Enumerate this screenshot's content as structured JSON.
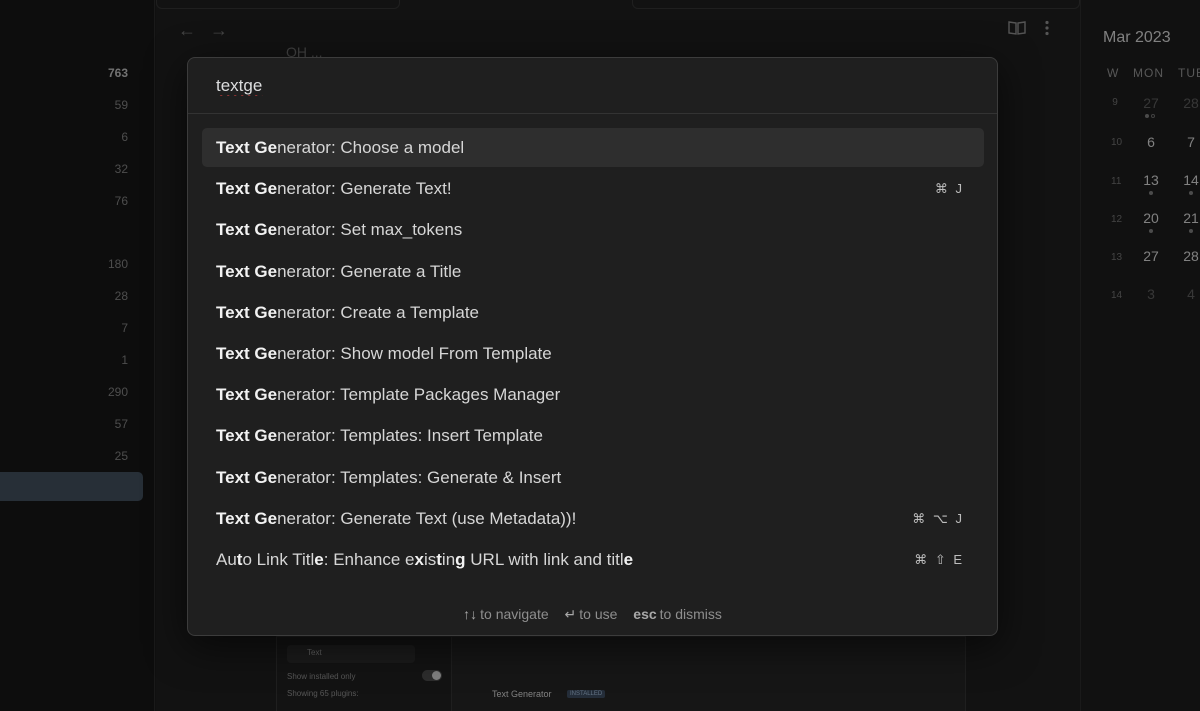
{
  "sidebar": {
    "counts": [
      "763",
      "59",
      "6",
      "32",
      "76",
      "180",
      "28",
      "7",
      "1",
      "290",
      "57",
      "25"
    ]
  },
  "main": {
    "back_icon": "arrow-left-icon",
    "forward_icon": "arrow-right-icon",
    "reading_icon": "book-open-icon",
    "more_icon": "more-vertical-icon",
    "background_title_fragment": "ОН ..."
  },
  "background_screenshot": {
    "search_value": "Text",
    "show_installed": "Show installed only",
    "showing_count": "Showing 65 plugins:",
    "plugin_name": "Text Generator",
    "badge": "INSTALLED"
  },
  "calendar": {
    "title": "Mar 2023",
    "headers": [
      "W",
      "MON",
      "TUE"
    ],
    "weeks": [
      {
        "week": "9",
        "mon": "27",
        "tue": "28",
        "muted": true
      },
      {
        "week": "10",
        "mon": "6",
        "tue": "7",
        "muted": false
      },
      {
        "week": "11",
        "mon": "13",
        "tue": "14",
        "muted": false
      },
      {
        "week": "12",
        "mon": "20",
        "tue": "21",
        "muted": false
      },
      {
        "week": "13",
        "mon": "27",
        "tue": "28",
        "muted": false
      },
      {
        "week": "14",
        "mon": "3",
        "tue": "4",
        "muted": true
      }
    ]
  },
  "palette": {
    "query": "textge",
    "items": [
      {
        "bold": "Text Ge",
        "rest": "nerator: Choose a model",
        "hotkey": ""
      },
      {
        "bold": "Text Ge",
        "rest": "nerator: Generate Text!",
        "hotkey": "⌘ J"
      },
      {
        "bold": "Text Ge",
        "rest": "nerator: Set max_tokens",
        "hotkey": ""
      },
      {
        "bold": "Text Ge",
        "rest": "nerator: Generate a Title",
        "hotkey": ""
      },
      {
        "bold": "Text Ge",
        "rest": "nerator: Create a Template",
        "hotkey": ""
      },
      {
        "bold": "Text Ge",
        "rest": "nerator: Show model From Template",
        "hotkey": ""
      },
      {
        "bold": "Text Ge",
        "rest": "nerator: Template Packages Manager",
        "hotkey": ""
      },
      {
        "bold": "Text Ge",
        "rest": "nerator: Templates: Insert Template",
        "hotkey": ""
      },
      {
        "bold": "Text Ge",
        "rest": "nerator: Templates: Generate & Insert",
        "hotkey": ""
      },
      {
        "bold": "Text Ge",
        "rest": "nerator: Generate Text (use Metadata))!",
        "hotkey": "⌘ ⌥ J"
      }
    ],
    "last_item": {
      "parts": [
        {
          "t": "Au",
          "b": false
        },
        {
          "t": "t",
          "b": true
        },
        {
          "t": "o Link Titl",
          "b": false
        },
        {
          "t": "e",
          "b": true
        },
        {
          "t": ": Enhance e",
          "b": false
        },
        {
          "t": "x",
          "b": true
        },
        {
          "t": "is",
          "b": false
        },
        {
          "t": "t",
          "b": true
        },
        {
          "t": "in",
          "b": false
        },
        {
          "t": "g",
          "b": true
        },
        {
          "t": " URL with link and titl",
          "b": false
        },
        {
          "t": "e",
          "b": true
        }
      ],
      "hotkey": "⌘ ⇧ E"
    },
    "footer": {
      "navigate_key": "↑↓",
      "navigate_label": "to navigate",
      "use_key": "↵",
      "use_label": "to use",
      "dismiss_key": "esc",
      "dismiss_label": "to dismiss"
    }
  }
}
